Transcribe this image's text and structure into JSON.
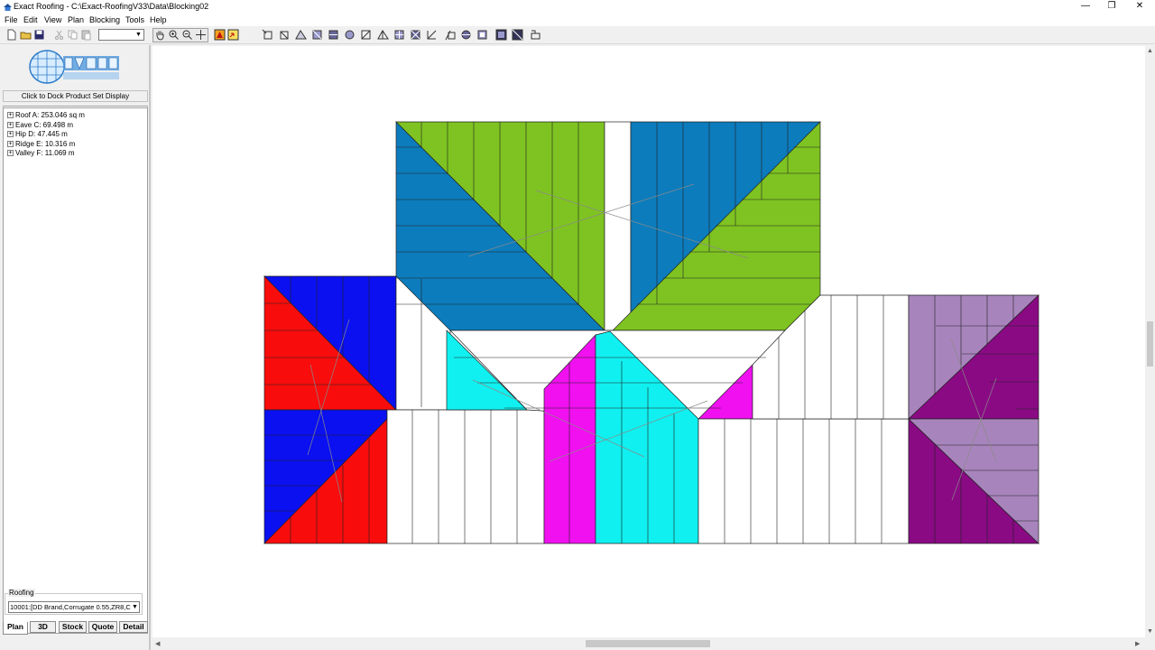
{
  "window": {
    "title": "Exact Roofing - C:\\Exact-RoofingV33\\Data\\Blocking02",
    "minimize": "—",
    "restore": "❐",
    "close": "✕"
  },
  "menu": [
    "File",
    "Edit",
    "View",
    "Plan",
    "Blocking",
    "Tools",
    "Help"
  ],
  "left_panel": {
    "dock_button": "Click to Dock Product Set Display",
    "tree": [
      {
        "expand": "+",
        "label": "Roof A: 253.046 sq m"
      },
      {
        "expand": "+",
        "label": "Eave C: 69.498 m"
      },
      {
        "expand": "+",
        "label": "Hip D: 47.445 m"
      },
      {
        "expand": "+",
        "label": "Ridge E: 10.316 m"
      },
      {
        "expand": "+",
        "label": "Valley F: 11.069 m"
      }
    ],
    "roofing_label": "Roofing",
    "roofing_value": "10001:[DD Brand,Corrugate 0.55,ZR8,Co",
    "tabs": [
      "Plan",
      "3D",
      "Stock",
      "Quote",
      "Detail"
    ],
    "active_tab": "Plan"
  },
  "colors": {
    "green": "#7ec321",
    "steel_blue": "#0c7cbc",
    "blue": "#0a10f0",
    "red": "#f80c0c",
    "cyan": "#10f0f0",
    "magenta": "#f010f0",
    "lilac": "#a884bc",
    "purple": "#8a0a84"
  }
}
